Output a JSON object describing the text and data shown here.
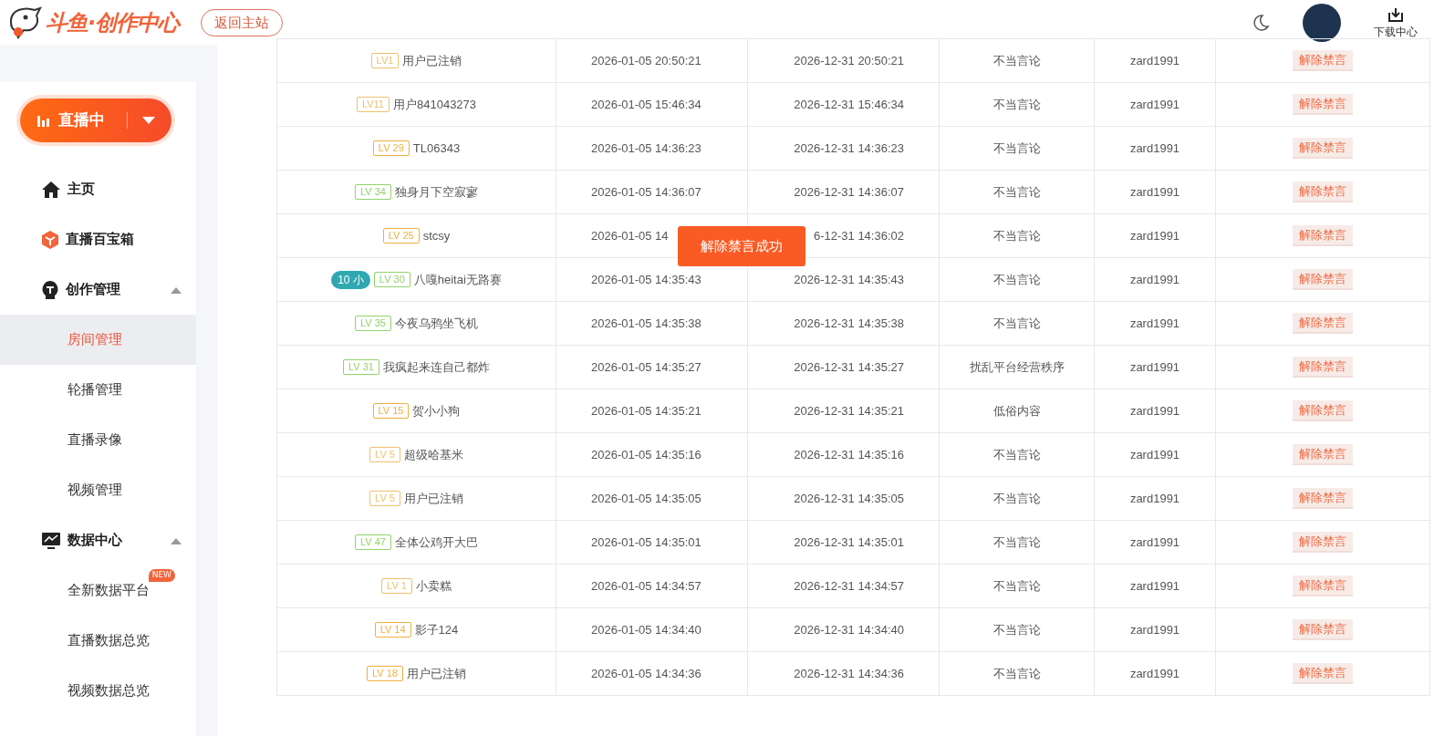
{
  "header": {
    "logo_text": "斗鱼·创作中心",
    "back_button": "返回主站",
    "download_label": "下载中心"
  },
  "sidebar": {
    "live_button": "直播中",
    "items": [
      {
        "label": "主页"
      },
      {
        "label": "直播百宝箱"
      },
      {
        "label": "创作管理",
        "expanded": true,
        "children": [
          {
            "label": "房间管理",
            "selected": true
          },
          {
            "label": "轮播管理",
            "selected": false
          },
          {
            "label": "直播录像",
            "selected": false
          },
          {
            "label": "视频管理",
            "selected": false
          }
        ]
      },
      {
        "label": "数据中心",
        "expanded": true,
        "children": [
          {
            "label": "全新数据平台",
            "selected": false,
            "badge": "NEW"
          },
          {
            "label": "直播数据总览",
            "selected": false
          },
          {
            "label": "视频数据总览",
            "selected": false
          }
        ]
      }
    ]
  },
  "toast": "解除禁言成功",
  "table": {
    "rows": [
      {
        "lv": "LV1",
        "color": "#f0c070",
        "name": "用户已注销",
        "start": "2026-01-05 20:50:21",
        "end": "2026-12-31 20:50:21",
        "reason": "不当言论",
        "operator": "zard1991",
        "action": "解除禁言"
      },
      {
        "lv": "LV11",
        "color": "#f0c070",
        "name": "用户841043273",
        "start": "2026-01-05 15:46:34",
        "end": "2026-12-31 15:46:34",
        "reason": "不当言论",
        "operator": "zard1991",
        "action": "解除禁言"
      },
      {
        "lv": "LV 29",
        "color": "#f0b040",
        "name": "TL06343",
        "start": "2026-01-05 14:36:23",
        "end": "2026-12-31 14:36:23",
        "reason": "不当言论",
        "operator": "zard1991",
        "action": "解除禁言"
      },
      {
        "lv": "LV 34",
        "color": "#8fd46a",
        "name": "独身月下空寂寥",
        "start": "2026-01-05 14:36:07",
        "end": "2026-12-31 14:36:07",
        "reason": "不当言论",
        "operator": "zard1991",
        "action": "解除禁言"
      },
      {
        "lv": "LV 25",
        "color": "#f0b040",
        "name": "stcsy",
        "start": "2026-01-05 14",
        "end": "6-12-31 14:36:02",
        "reason": "不当言论",
        "operator": "zard1991",
        "action": "解除禁言"
      },
      {
        "lv": "LV 30",
        "color": "#8fd46a",
        "name": "八嘎heitai无路赛",
        "fan_badge": {
          "number": "10",
          "name": "小"
        },
        "start": "2026-01-05 14:35:43",
        "end": "2026-12-31 14:35:43",
        "reason": "不当言论",
        "operator": "zard1991",
        "action": "解除禁言"
      },
      {
        "lv": "LV 35",
        "color": "#8fd46a",
        "name": "今夜乌鸦坐飞机",
        "start": "2026-01-05 14:35:38",
        "end": "2026-12-31 14:35:38",
        "reason": "不当言论",
        "operator": "zard1991",
        "action": "解除禁言"
      },
      {
        "lv": "LV 31",
        "color": "#8fd46a",
        "name": "我疯起来连自己都炸",
        "start": "2026-01-05 14:35:27",
        "end": "2026-12-31 14:35:27",
        "reason": "扰乱平台经营秩序",
        "operator": "zard1991",
        "action": "解除禁言"
      },
      {
        "lv": "LV 15",
        "color": "#f0b040",
        "name": "贺小小狗",
        "start": "2026-01-05 14:35:21",
        "end": "2026-12-31 14:35:21",
        "reason": "低俗内容",
        "operator": "zard1991",
        "action": "解除禁言"
      },
      {
        "lv": "LV 5",
        "color": "#f0c070",
        "name": "超级哈基米",
        "start": "2026-01-05 14:35:16",
        "end": "2026-12-31 14:35:16",
        "reason": "不当言论",
        "operator": "zard1991",
        "action": "解除禁言"
      },
      {
        "lv": "LV 5",
        "color": "#f0c070",
        "name": "用户已注销",
        "start": "2026-01-05 14:35:05",
        "end": "2026-12-31 14:35:05",
        "reason": "不当言论",
        "operator": "zard1991",
        "action": "解除禁言"
      },
      {
        "lv": "LV 47",
        "color": "#8fd46a",
        "name": "全体公鸡开大巴",
        "start": "2026-01-05 14:35:01",
        "end": "2026-12-31 14:35:01",
        "reason": "不当言论",
        "operator": "zard1991",
        "action": "解除禁言"
      },
      {
        "lv": "LV 1",
        "color": "#f0c070",
        "name": "小卖糕",
        "start": "2026-01-05 14:34:57",
        "end": "2026-12-31 14:34:57",
        "reason": "不当言论",
        "operator": "zard1991",
        "action": "解除禁言"
      },
      {
        "lv": "LV 14",
        "color": "#f0b040",
        "name": "影子124",
        "start": "2026-01-05 14:34:40",
        "end": "2026-12-31 14:34:40",
        "reason": "不当言论",
        "operator": "zard1991",
        "action": "解除禁言"
      },
      {
        "lv": "LV 18",
        "color": "#f0b040",
        "name": "用户已注销",
        "start": "2026-01-05 14:34:36",
        "end": "2026-12-31 14:34:36",
        "reason": "不当言论",
        "operator": "zard1991",
        "action": "解除禁言"
      }
    ]
  }
}
